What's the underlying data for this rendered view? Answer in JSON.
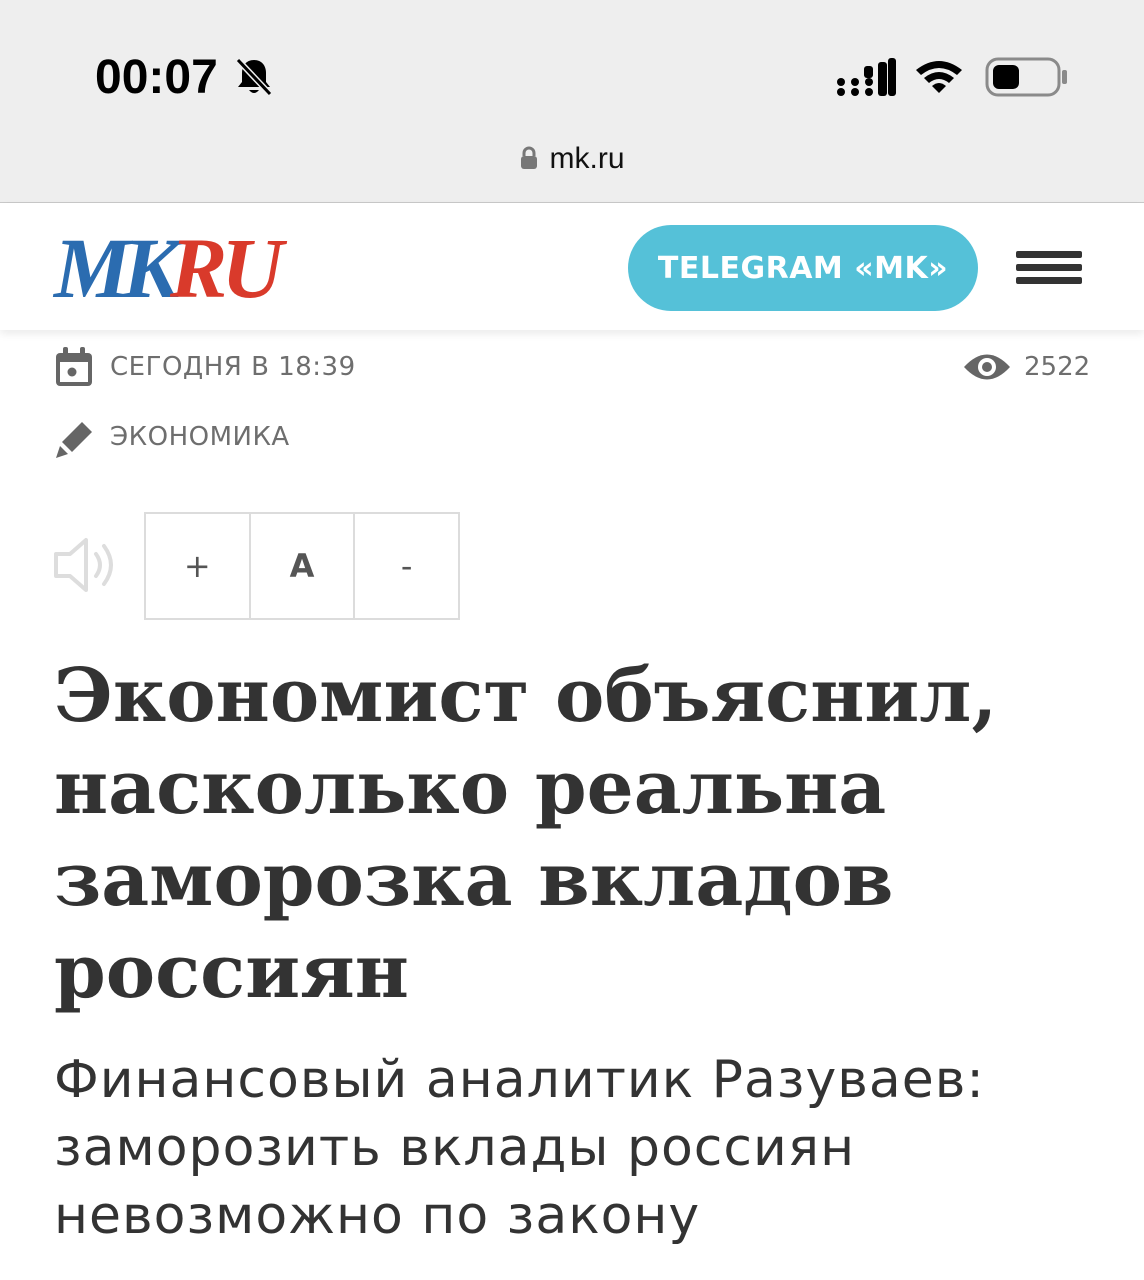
{
  "status_bar": {
    "time": "00:07",
    "icons": [
      "bell-slash-icon",
      "cellular-signal-icon",
      "wifi-icon",
      "battery-icon"
    ]
  },
  "browser": {
    "url": "mk.ru",
    "lock_icon": "lock-icon"
  },
  "header": {
    "logo_text": "MKRU",
    "telegram_label": "TELEGRAM «MK»",
    "menu_icon": "hamburger-menu-icon",
    "colors": {
      "logo_blue": "#2b6cb0",
      "logo_red": "#d93a2b",
      "telegram_bg": "#55c1d8"
    }
  },
  "article": {
    "date": "СЕГОДНЯ В 18:39",
    "views": "2522",
    "rubric": "ЭКОНОМИКА",
    "font_controls": {
      "increase": "+",
      "reset": "A",
      "decrease": "-"
    },
    "headline": "Экономист объяснил, насколько реальна заморозка вкладов россиян",
    "subtitle": "Финансовый аналитик Разуваев: заморозить вклады россиян невозможно по закону"
  }
}
